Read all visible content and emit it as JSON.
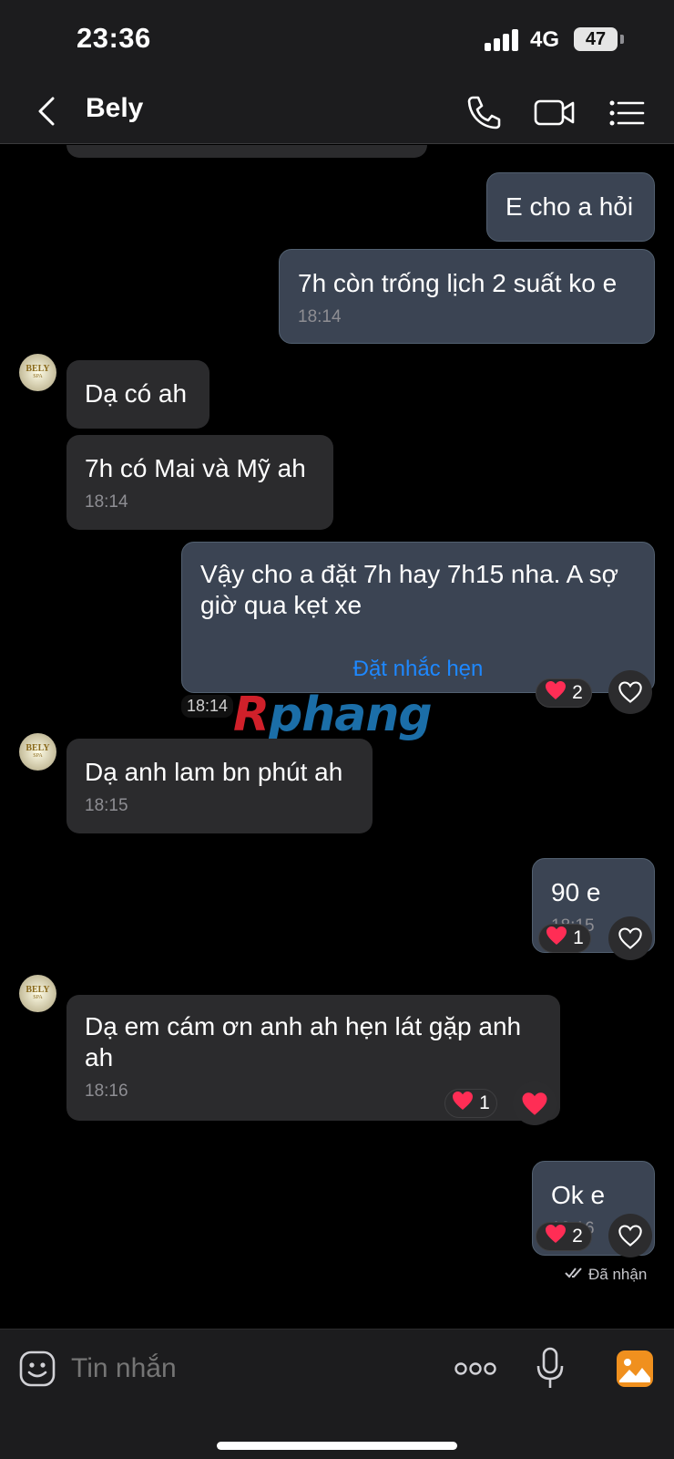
{
  "status_bar": {
    "time": "23:36",
    "network": "4G",
    "battery": "47"
  },
  "header": {
    "title": "Bely",
    "icons": [
      "back-chevron-icon",
      "phone-icon",
      "video-icon",
      "list-menu-icon"
    ]
  },
  "avatar": {
    "line1": "BELY",
    "line2": "SPA"
  },
  "messages": [
    {
      "direction": "outgoing",
      "text": "E cho a hỏi"
    },
    {
      "direction": "outgoing",
      "text": "7h còn trống lịch 2 suất ko e",
      "time": "18:14"
    },
    {
      "direction": "incoming",
      "text": "Dạ có ah"
    },
    {
      "direction": "incoming",
      "text": "7h có Mai và Mỹ ah",
      "time": "18:14"
    },
    {
      "direction": "outgoing",
      "text": "Vậy cho a đặt 7h hay 7h15 nha. A sợ giờ qua kẹt xe",
      "action": "Đặt nhắc hẹn",
      "time": "18:14",
      "reaction_count": "2"
    },
    {
      "direction": "incoming",
      "text": "Dạ anh lam bn phút ah",
      "time": "18:15"
    },
    {
      "direction": "outgoing",
      "text": "90 e",
      "time": "18:15",
      "reaction_count": "1"
    },
    {
      "direction": "incoming",
      "text": "Dạ em cám ơn anh ah hẹn lát gặp anh ah",
      "time": "18:16",
      "reaction_count": "1"
    },
    {
      "direction": "outgoing",
      "text": "Ok e",
      "time": "18:16",
      "reaction_count": "2"
    }
  ],
  "delivery_status": "Đã nhận",
  "watermark": {
    "part1": "R",
    "part2": "phang"
  },
  "composer": {
    "placeholder": "Tin nhắn"
  },
  "colors": {
    "accent": "#1e88ff",
    "heart": "#ff2d55",
    "outgoing_bubble": "#3b4453",
    "incoming_bubble": "#2b2b2d",
    "media_button": "#f0901e"
  }
}
